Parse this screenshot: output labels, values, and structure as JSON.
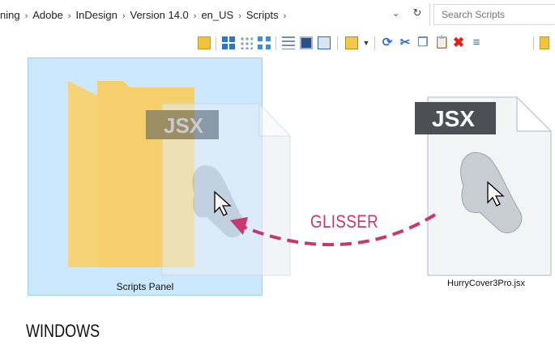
{
  "breadcrumb": {
    "items": [
      "ning",
      "Adobe",
      "InDesign",
      "Version 14.0",
      "en_US",
      "Scripts"
    ],
    "separator": "›"
  },
  "search": {
    "placeholder": "Search Scripts"
  },
  "toolbar": {
    "icons": [
      "new-folder-icon",
      "tiles-view-icon",
      "small-icons-view-icon",
      "large-icons-view-icon",
      "details-view-icon",
      "thumbnail-view-icon",
      "preview-pane-icon",
      "select-icon",
      "dropdown-icon",
      "refresh-icon",
      "cut-icon",
      "copy-icon",
      "paste-icon",
      "delete-icon",
      "properties-icon",
      "folder-icon"
    ]
  },
  "folder": {
    "label": "Scripts Panel"
  },
  "file": {
    "label": "HurryCover3Pro.jsx",
    "badge": "JSX"
  },
  "drag_ghost": {
    "badge": "JSX"
  },
  "annotation": {
    "text": "GLISSER",
    "color": "#c8376d"
  },
  "caption": {
    "text": "WINDOWS"
  },
  "colors": {
    "selection_fill": "#cce8ff",
    "selection_border": "#99d1ff",
    "folder": "#f4cf6b"
  }
}
